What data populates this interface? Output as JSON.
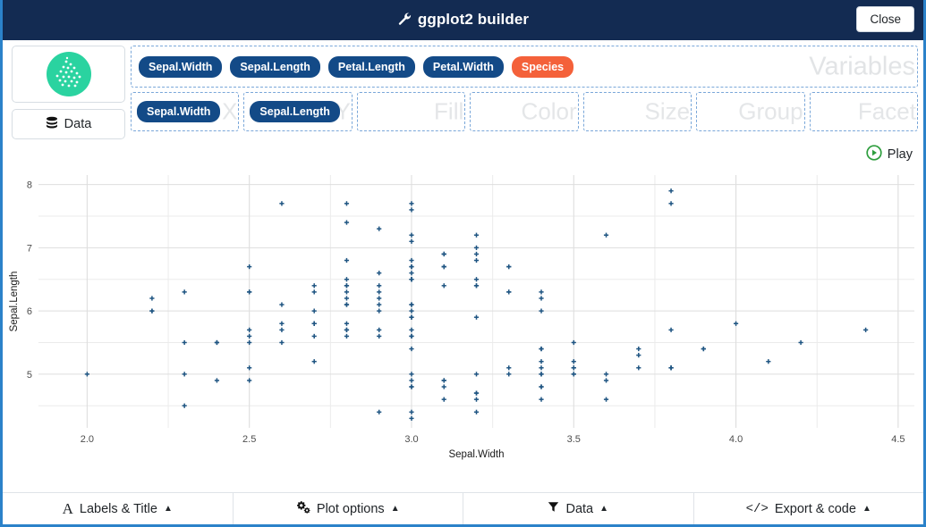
{
  "window": {
    "title": "ggplot2 builder",
    "title_icon": "wrench-icon",
    "close_label": "Close",
    "accent_color": "#132b52",
    "border_color": "#2b82c9"
  },
  "sidebar": {
    "thumbnail_name": "scatter-plot-thumbnail",
    "thumbnail_color": "#2ad3a0",
    "data_button_label": "Data",
    "data_button_icon": "database-icon"
  },
  "variables": {
    "zone_label": "Variables",
    "items": [
      {
        "label": "Sepal.Width",
        "color": "#134a87"
      },
      {
        "label": "Sepal.Length",
        "color": "#134a87"
      },
      {
        "label": "Petal.Length",
        "color": "#134a87"
      },
      {
        "label": "Petal.Width",
        "color": "#134a87"
      },
      {
        "label": "Species",
        "color": "#f4613a"
      }
    ]
  },
  "aesthetics": [
    {
      "zone_label": "X",
      "value": "Sepal.Width",
      "filled": true
    },
    {
      "zone_label": "Y",
      "value": "Sepal.Length",
      "filled": true
    },
    {
      "zone_label": "Fill",
      "value": "",
      "filled": false
    },
    {
      "zone_label": "Color",
      "value": "",
      "filled": false
    },
    {
      "zone_label": "Size",
      "value": "",
      "filled": false
    },
    {
      "zone_label": "Group",
      "value": "",
      "filled": false
    },
    {
      "zone_label": "Facet",
      "value": "",
      "filled": false
    }
  ],
  "play": {
    "label": "Play",
    "icon": "play-circle-icon",
    "color": "#2e9e3e"
  },
  "bottom_bar": [
    {
      "label": "Labels & Title",
      "icon": "font-a-icon",
      "caret": "▲"
    },
    {
      "label": "Plot options",
      "icon": "gears-icon",
      "caret": "▲"
    },
    {
      "label": "Data",
      "icon": "filter-icon",
      "caret": "▲"
    },
    {
      "label": "Export & code",
      "icon": "code-icon",
      "caret": "▲"
    }
  ],
  "chart_data": {
    "type": "scatter",
    "title": "",
    "xlabel": "Sepal.Width",
    "ylabel": "Sepal.Length",
    "xlim": [
      1.85,
      4.55
    ],
    "ylim": [
      4.15,
      8.15
    ],
    "xticks": [
      "2.0",
      "2.5",
      "3.0",
      "3.5",
      "4.0",
      "4.5"
    ],
    "xtick_values": [
      2.0,
      2.5,
      3.0,
      3.5,
      4.0,
      4.5
    ],
    "yticks": [
      "5",
      "6",
      "7",
      "8"
    ],
    "ytick_values": [
      5,
      6,
      7,
      8
    ],
    "minor_xticks": [
      2.25,
      2.75,
      3.25,
      3.75,
      4.25
    ],
    "minor_yticks": [
      4.5,
      5.5,
      6.5,
      7.5
    ],
    "grid": true,
    "legend": "none",
    "point_color": "#1f5582",
    "point_shape": "plus",
    "points": [
      [
        3.5,
        5.1
      ],
      [
        3.0,
        4.9
      ],
      [
        3.2,
        4.7
      ],
      [
        3.1,
        4.6
      ],
      [
        3.6,
        5.0
      ],
      [
        3.9,
        5.4
      ],
      [
        3.4,
        4.6
      ],
      [
        3.4,
        5.0
      ],
      [
        2.9,
        4.4
      ],
      [
        3.1,
        4.9
      ],
      [
        3.7,
        5.4
      ],
      [
        3.4,
        4.8
      ],
      [
        3.0,
        4.8
      ],
      [
        3.0,
        4.3
      ],
      [
        4.0,
        5.8
      ],
      [
        4.4,
        5.7
      ],
      [
        3.9,
        5.4
      ],
      [
        3.5,
        5.1
      ],
      [
        3.8,
        5.7
      ],
      [
        3.8,
        5.1
      ],
      [
        3.4,
        5.4
      ],
      [
        3.7,
        5.1
      ],
      [
        3.6,
        4.6
      ],
      [
        3.3,
        5.1
      ],
      [
        3.4,
        4.8
      ],
      [
        3.0,
        5.0
      ],
      [
        3.4,
        5.0
      ],
      [
        3.5,
        5.2
      ],
      [
        3.4,
        5.2
      ],
      [
        3.2,
        4.7
      ],
      [
        3.1,
        4.8
      ],
      [
        3.4,
        5.4
      ],
      [
        4.1,
        5.2
      ],
      [
        4.2,
        5.5
      ],
      [
        3.1,
        4.9
      ],
      [
        3.2,
        5.0
      ],
      [
        3.5,
        5.5
      ],
      [
        3.6,
        4.9
      ],
      [
        3.0,
        4.4
      ],
      [
        3.4,
        5.1
      ],
      [
        3.5,
        5.0
      ],
      [
        2.3,
        4.5
      ],
      [
        3.2,
        4.4
      ],
      [
        3.5,
        5.0
      ],
      [
        3.8,
        5.1
      ],
      [
        3.0,
        4.8
      ],
      [
        3.8,
        5.1
      ],
      [
        3.2,
        4.6
      ],
      [
        3.7,
        5.3
      ],
      [
        3.3,
        5.0
      ],
      [
        3.2,
        7.0
      ],
      [
        3.2,
        6.4
      ],
      [
        3.1,
        6.9
      ],
      [
        2.3,
        5.5
      ],
      [
        2.8,
        6.5
      ],
      [
        2.8,
        5.7
      ],
      [
        3.3,
        6.3
      ],
      [
        2.4,
        4.9
      ],
      [
        2.9,
        6.6
      ],
      [
        2.7,
        5.2
      ],
      [
        2.0,
        5.0
      ],
      [
        3.0,
        5.9
      ],
      [
        2.2,
        6.0
      ],
      [
        2.9,
        6.1
      ],
      [
        2.9,
        5.6
      ],
      [
        3.1,
        6.7
      ],
      [
        3.0,
        5.6
      ],
      [
        2.7,
        5.8
      ],
      [
        2.2,
        6.2
      ],
      [
        2.5,
        5.6
      ],
      [
        3.2,
        5.9
      ],
      [
        2.8,
        6.1
      ],
      [
        2.5,
        6.3
      ],
      [
        2.8,
        6.1
      ],
      [
        2.9,
        6.4
      ],
      [
        3.0,
        6.6
      ],
      [
        2.8,
        6.8
      ],
      [
        3.0,
        6.7
      ],
      [
        2.9,
        6.0
      ],
      [
        2.6,
        5.7
      ],
      [
        2.4,
        5.5
      ],
      [
        2.4,
        5.5
      ],
      [
        2.7,
        5.8
      ],
      [
        2.7,
        6.0
      ],
      [
        3.0,
        5.4
      ],
      [
        3.4,
        6.0
      ],
      [
        3.1,
        6.7
      ],
      [
        2.3,
        6.3
      ],
      [
        3.0,
        5.6
      ],
      [
        2.5,
        5.5
      ],
      [
        2.6,
        5.5
      ],
      [
        3.0,
        6.1
      ],
      [
        2.6,
        5.8
      ],
      [
        2.3,
        5.0
      ],
      [
        2.7,
        5.6
      ],
      [
        3.0,
        5.7
      ],
      [
        2.9,
        5.7
      ],
      [
        2.9,
        6.2
      ],
      [
        2.5,
        5.1
      ],
      [
        2.8,
        5.7
      ],
      [
        3.3,
        6.3
      ],
      [
        2.7,
        5.8
      ],
      [
        3.0,
        7.1
      ],
      [
        2.9,
        6.3
      ],
      [
        3.0,
        6.5
      ],
      [
        3.0,
        7.6
      ],
      [
        2.5,
        4.9
      ],
      [
        2.9,
        7.3
      ],
      [
        2.5,
        6.7
      ],
      [
        3.6,
        7.2
      ],
      [
        3.2,
        6.5
      ],
      [
        2.7,
        6.4
      ],
      [
        3.0,
        6.8
      ],
      [
        2.5,
        5.7
      ],
      [
        2.8,
        5.8
      ],
      [
        3.2,
        6.4
      ],
      [
        3.0,
        6.5
      ],
      [
        3.8,
        7.7
      ],
      [
        2.6,
        7.7
      ],
      [
        2.2,
        6.0
      ],
      [
        3.2,
        6.9
      ],
      [
        2.8,
        5.6
      ],
      [
        2.8,
        7.7
      ],
      [
        2.7,
        6.3
      ],
      [
        3.3,
        6.7
      ],
      [
        3.2,
        7.2
      ],
      [
        2.8,
        6.2
      ],
      [
        3.0,
        6.1
      ],
      [
        2.8,
        6.4
      ],
      [
        3.0,
        7.2
      ],
      [
        2.8,
        7.4
      ],
      [
        3.8,
        7.9
      ],
      [
        2.8,
        6.4
      ],
      [
        2.8,
        6.3
      ],
      [
        2.6,
        6.1
      ],
      [
        3.0,
        7.7
      ],
      [
        3.4,
        6.3
      ],
      [
        3.1,
        6.4
      ],
      [
        3.0,
        6.0
      ],
      [
        3.1,
        6.9
      ],
      [
        3.1,
        6.7
      ],
      [
        3.1,
        6.9
      ],
      [
        2.7,
        5.8
      ],
      [
        3.2,
        6.8
      ],
      [
        3.3,
        6.7
      ],
      [
        3.0,
        6.7
      ],
      [
        2.5,
        6.3
      ],
      [
        3.0,
        6.5
      ],
      [
        3.4,
        6.2
      ],
      [
        3.0,
        5.9
      ]
    ]
  }
}
